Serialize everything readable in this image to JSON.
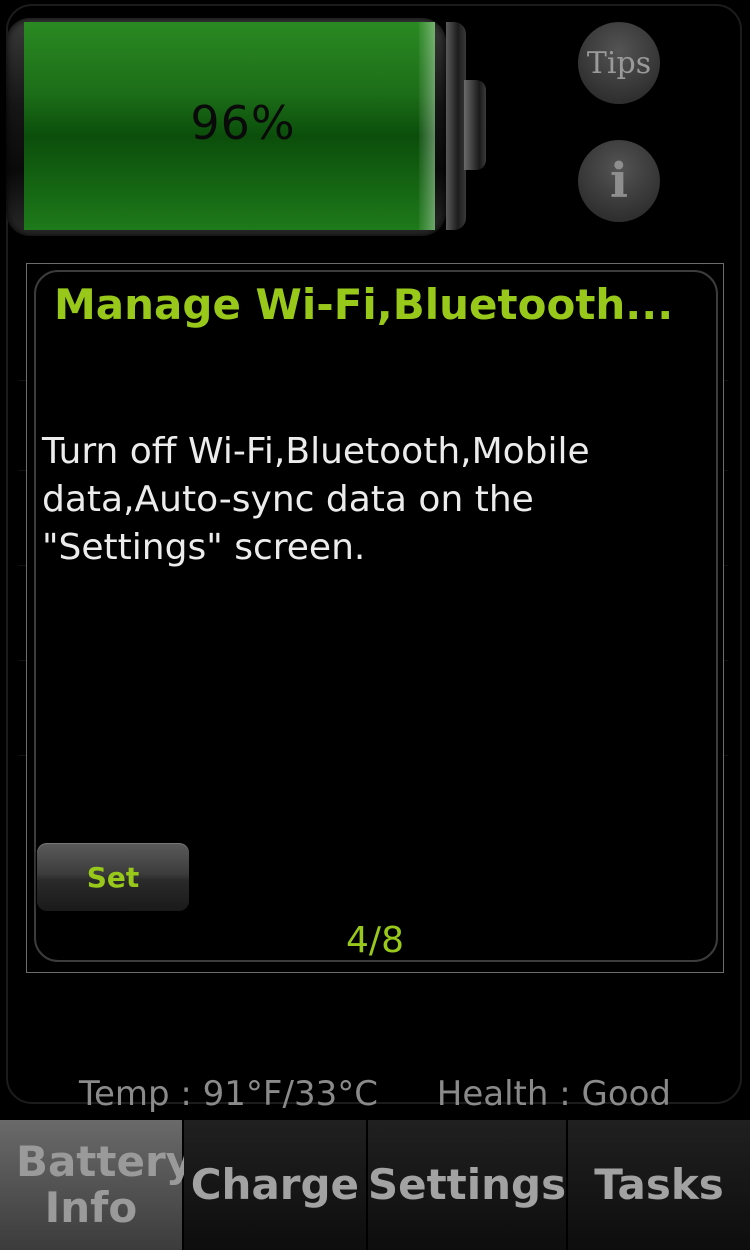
{
  "battery": {
    "percent_label": "96%",
    "level": 0.96
  },
  "header_buttons": {
    "tips_label": "Tips",
    "info_label": "i"
  },
  "dialog": {
    "title": "Manage Wi-Fi,Bluetooth...",
    "body": "Turn off Wi-Fi,Bluetooth,Mobile data,Auto-sync data on the \"Settings\" screen.",
    "set_label": "Set",
    "page_indicator": "4/8"
  },
  "status": {
    "temp": "Temp : 91°F/33°C",
    "health": "Health : Good"
  },
  "tabs": [
    {
      "label": "Battery Info",
      "active": true
    },
    {
      "label": "Charge",
      "active": false
    },
    {
      "label": "Settings",
      "active": false
    },
    {
      "label": "Tasks",
      "active": false
    }
  ],
  "colors": {
    "accent": "#98c81a",
    "battery_fill": "#1c6d18",
    "background": "#000000"
  }
}
